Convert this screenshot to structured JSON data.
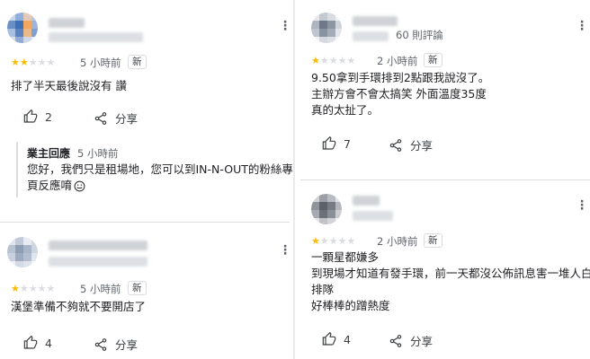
{
  "colors": {
    "star": "#fbbc04",
    "star_empty": "#dadce0",
    "muted_text": "#5f6368",
    "divider": "#dadce0"
  },
  "icons": {
    "thumb": "thumb-up-icon",
    "share": "share-icon",
    "menu": "more-vert-icon",
    "emoji": "smile-emoji-icon"
  },
  "left": {
    "reviews": [
      {
        "rating": 2,
        "time": "5 小時前",
        "badge": "新",
        "lines": [
          "排了半天最後說沒有 讚"
        ],
        "likes": "2",
        "share_label": "分享",
        "owner_reply": {
          "title": "業主回應",
          "time": "5 小時前",
          "lines": [
            "您好，我們只是租場地，您可以到IN-N-OUT的粉絲專",
            "頁反應唷"
          ]
        }
      },
      {
        "rating": 1,
        "time": "5 小時前",
        "badge": "新",
        "lines": [
          "漢堡準備不夠就不要開店了"
        ],
        "likes": "4",
        "share_label": "分享"
      }
    ]
  },
  "right": {
    "reviews": [
      {
        "rating": 1,
        "reviewer_count": "60 則評論",
        "time": "2 小時前",
        "badge": "新",
        "lines": [
          "9.50拿到手環排到2點跟我說沒了。",
          "主辦方會不會太搞笑 外面溫度35度",
          "真的太扯了。"
        ],
        "likes": "7",
        "share_label": "分享"
      },
      {
        "rating": 1,
        "time": "2 小時前",
        "badge": "新",
        "lines": [
          "一顆星都嫌多",
          "到現場才知道有發手環，前一天都沒公佈訊息害一堆人白",
          "排隊",
          "好棒棒的蹭熱度"
        ],
        "likes": "4",
        "share_label": "分享"
      }
    ]
  }
}
